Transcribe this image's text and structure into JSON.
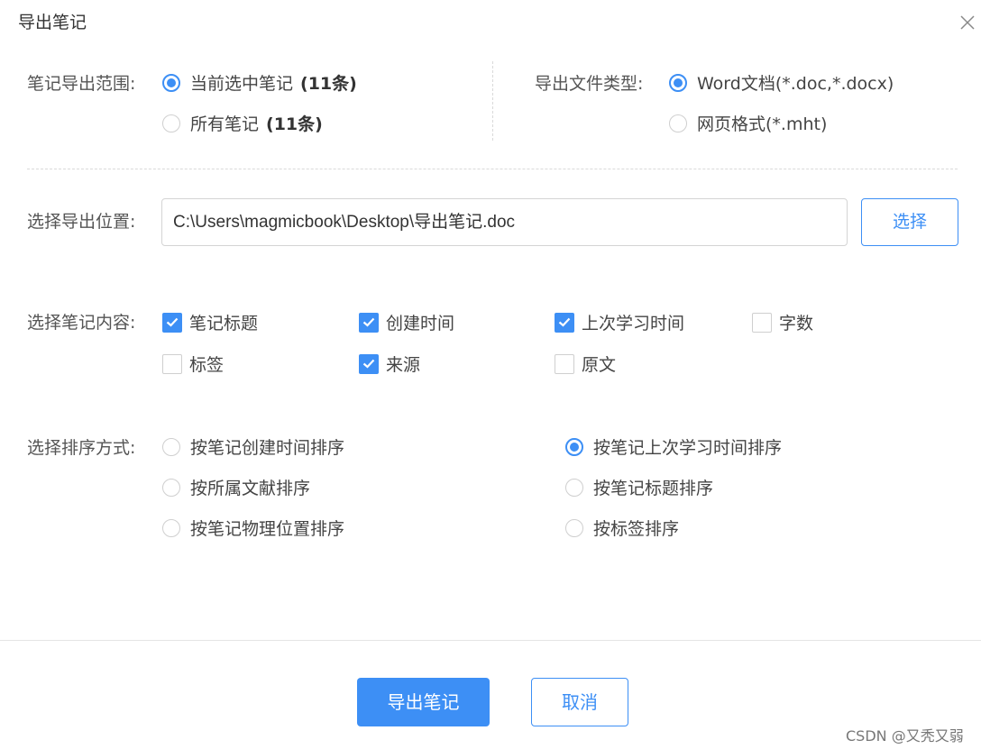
{
  "dialog": {
    "title": "导出笔记",
    "close_icon": "close-icon"
  },
  "scope": {
    "label": "笔记导出范围:",
    "options": [
      {
        "text": "当前选中笔记",
        "count": "(11条)",
        "selected": true
      },
      {
        "text": "所有笔记",
        "count": "(11条)",
        "selected": false
      }
    ]
  },
  "filetype": {
    "label": "导出文件类型:",
    "options": [
      {
        "text": "Word文档(*.doc,*.docx)",
        "selected": true
      },
      {
        "text": "网页格式(*.mht)",
        "selected": false
      }
    ]
  },
  "location": {
    "label": "选择导出位置:",
    "path": "C:\\Users\\magmicbook\\Desktop\\导出笔记.doc",
    "button": "选择"
  },
  "content": {
    "label": "选择笔记内容:",
    "items": [
      {
        "text": "笔记标题",
        "checked": true
      },
      {
        "text": "创建时间",
        "checked": true
      },
      {
        "text": "上次学习时间",
        "checked": true
      },
      {
        "text": "字数",
        "checked": false
      },
      {
        "text": "标签",
        "checked": false
      },
      {
        "text": "来源",
        "checked": true
      },
      {
        "text": "原文",
        "checked": false
      }
    ]
  },
  "sort": {
    "label": "选择排序方式:",
    "options": [
      {
        "text": "按笔记创建时间排序",
        "selected": false
      },
      {
        "text": "按所属文献排序",
        "selected": false
      },
      {
        "text": "按笔记物理位置排序",
        "selected": false
      },
      {
        "text": "按笔记上次学习时间排序",
        "selected": true
      },
      {
        "text": "按笔记标题排序",
        "selected": false
      },
      {
        "text": "按标签排序",
        "selected": false
      }
    ]
  },
  "footer": {
    "export_label": "导出笔记",
    "cancel_label": "取消"
  },
  "watermark": "CSDN @又秃又弱",
  "colors": {
    "accent": "#3d8ff5",
    "border": "#cfcfcf",
    "text": "#444444"
  }
}
